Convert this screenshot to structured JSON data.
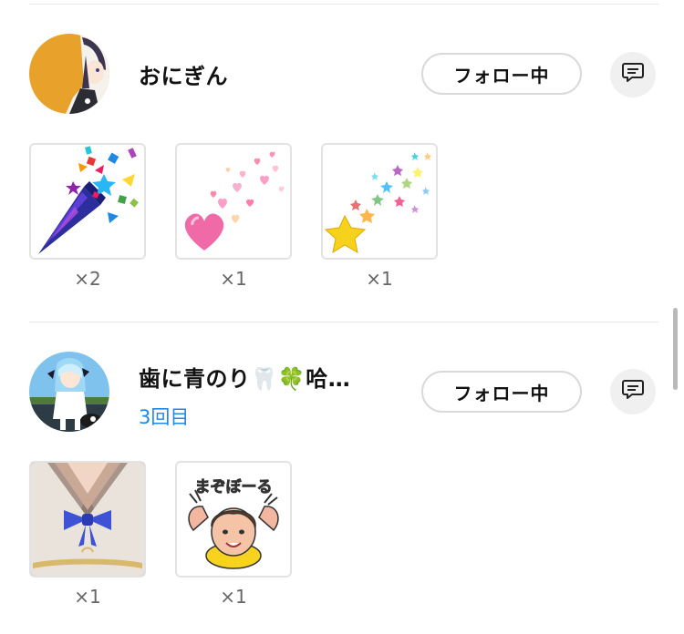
{
  "users": [
    {
      "name": "おにぎん",
      "visits": "",
      "follow_label": "フォロー中",
      "message_icon": "chat-bubble-icon",
      "gifts": [
        {
          "icon": "party-cracker-icon",
          "count": "×2"
        },
        {
          "icon": "hearts-burst-icon",
          "count": "×1"
        },
        {
          "icon": "stars-burst-icon",
          "count": "×1"
        }
      ]
    },
    {
      "name": "歯に青のり🦷🍀哈…",
      "visits": "3回目",
      "follow_label": "フォロー中",
      "message_icon": "chat-bubble-icon",
      "gifts": [
        {
          "icon": "blue-ribbon-illustration-icon",
          "count": "×1"
        },
        {
          "icon": "mazobooru-sticker-icon",
          "count": "×1"
        }
      ]
    }
  ],
  "colors": {
    "accent": "#1e88e5",
    "divider": "#e7e7e7",
    "button_border": "#d9d9d9"
  },
  "sticker_text": "まぞぼーる"
}
